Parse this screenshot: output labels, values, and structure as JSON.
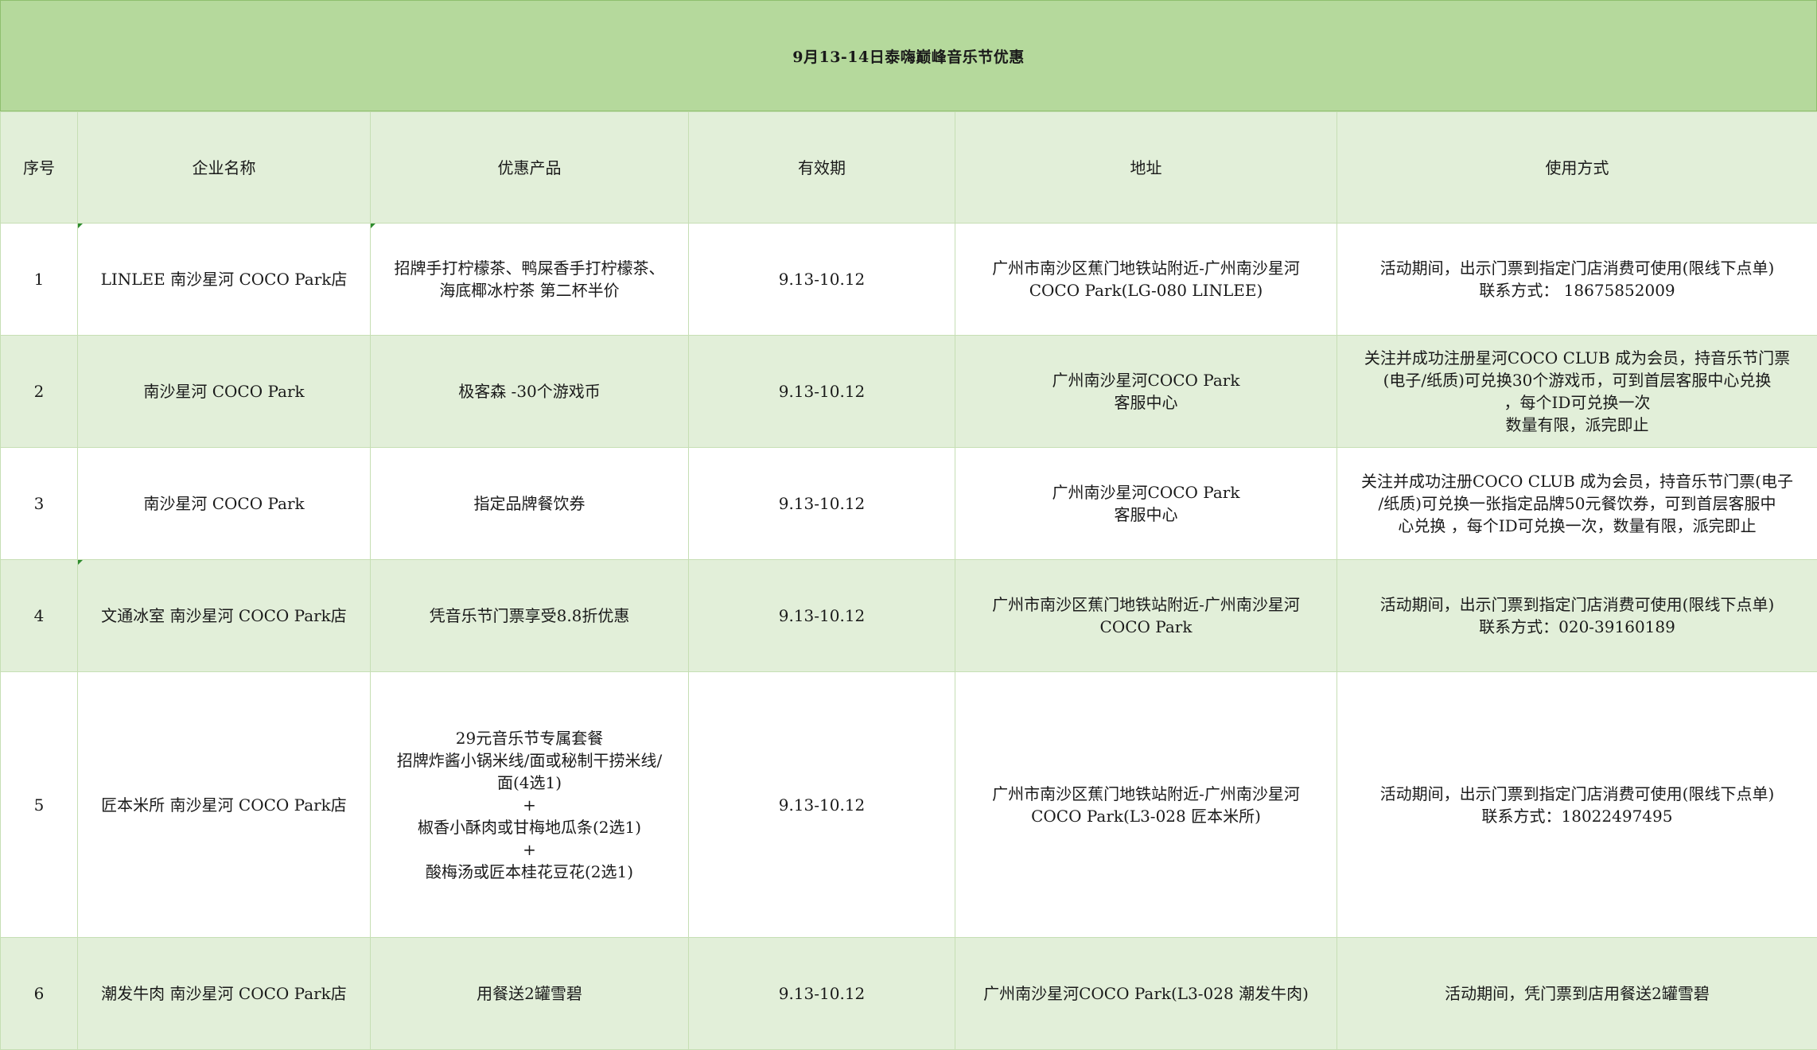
{
  "title": "9月13-14日泰嗨巅峰音乐节优惠",
  "headers": [
    "序号",
    "企业名称",
    "优惠产品",
    "有效期",
    "地址",
    "使用方式"
  ],
  "rows": [
    {
      "no": "1",
      "company": "LINLEE 南沙星河 COCO Park店",
      "product": "招牌手打柠檬茶、鸭屎香手打柠檬茶、\n海底椰冰柠茶 第二杯半价",
      "validity": "9.13-10.12",
      "address": "广州市南沙区蕉门地铁站附近-广州南沙星河\nCOCO Park(LG-080 LINLEE)",
      "usage": "活动期间，出示门票到指定门店消费可使用(限线下点单)\n联系方式：    18675852009"
    },
    {
      "no": "2",
      "company": "南沙星河 COCO Park",
      "product": "极客森 -30个游戏币",
      "validity": "9.13-10.12",
      "address": "广州南沙星河COCO Park\n客服中心",
      "usage": "关注并成功注册星河COCO CLUB 成为会员，持音乐节门票\n(电子/纸质)可兑换30个游戏币，可到首层客服中心兑换\n，每个ID可兑换一次\n数量有限，派完即止"
    },
    {
      "no": "3",
      "company": "南沙星河 COCO Park",
      "product": "指定品牌餐饮券",
      "validity": "9.13-10.12",
      "address": "广州南沙星河COCO Park\n客服中心",
      "usage": "关注并成功注册COCO CLUB 成为会员，持音乐节门票(电子\n/纸质)可兑换一张指定品牌50元餐饮券，可到首层客服中\n心兑换 ，每个ID可兑换一次，数量有限，派完即止"
    },
    {
      "no": "4",
      "company": "文通冰室 南沙星河 COCO Park店",
      "product": "凭音乐节门票享受8.8折优惠",
      "validity": "9.13-10.12",
      "address": "广州市南沙区蕉门地铁站附近-广州南沙星河\nCOCO Park",
      "usage": "活动期间，出示门票到指定门店消费可使用(限线下点单)\n联系方式：020-39160189"
    },
    {
      "no": "5",
      "company": "匠本米所 南沙星河 COCO Park店",
      "product": "29元音乐节专属套餐\n招牌炸酱小锅米线/面或秘制干捞米线/\n面(4选1)\n+\n椒香小酥肉或甘梅地瓜条(2选1)\n+\n酸梅汤或匠本桂花豆花(2选1)",
      "validity": "9.13-10.12",
      "address": "广州市南沙区蕉门地铁站附近-广州南沙星河\nCOCO Park(L3-028 匠本米所)",
      "usage": "活动期间，出示门票到指定门店消费可使用(限线下点单)\n联系方式：18022497495"
    },
    {
      "no": "6",
      "company": "潮发牛肉 南沙星河 COCO Park店",
      "product": "用餐送2罐雪碧",
      "validity": "9.13-10.12",
      "address": "广州南沙星河COCO Park(L3-028 潮发牛肉)",
      "usage": "活动期间，凭门票到店用餐送2罐雪碧"
    }
  ]
}
